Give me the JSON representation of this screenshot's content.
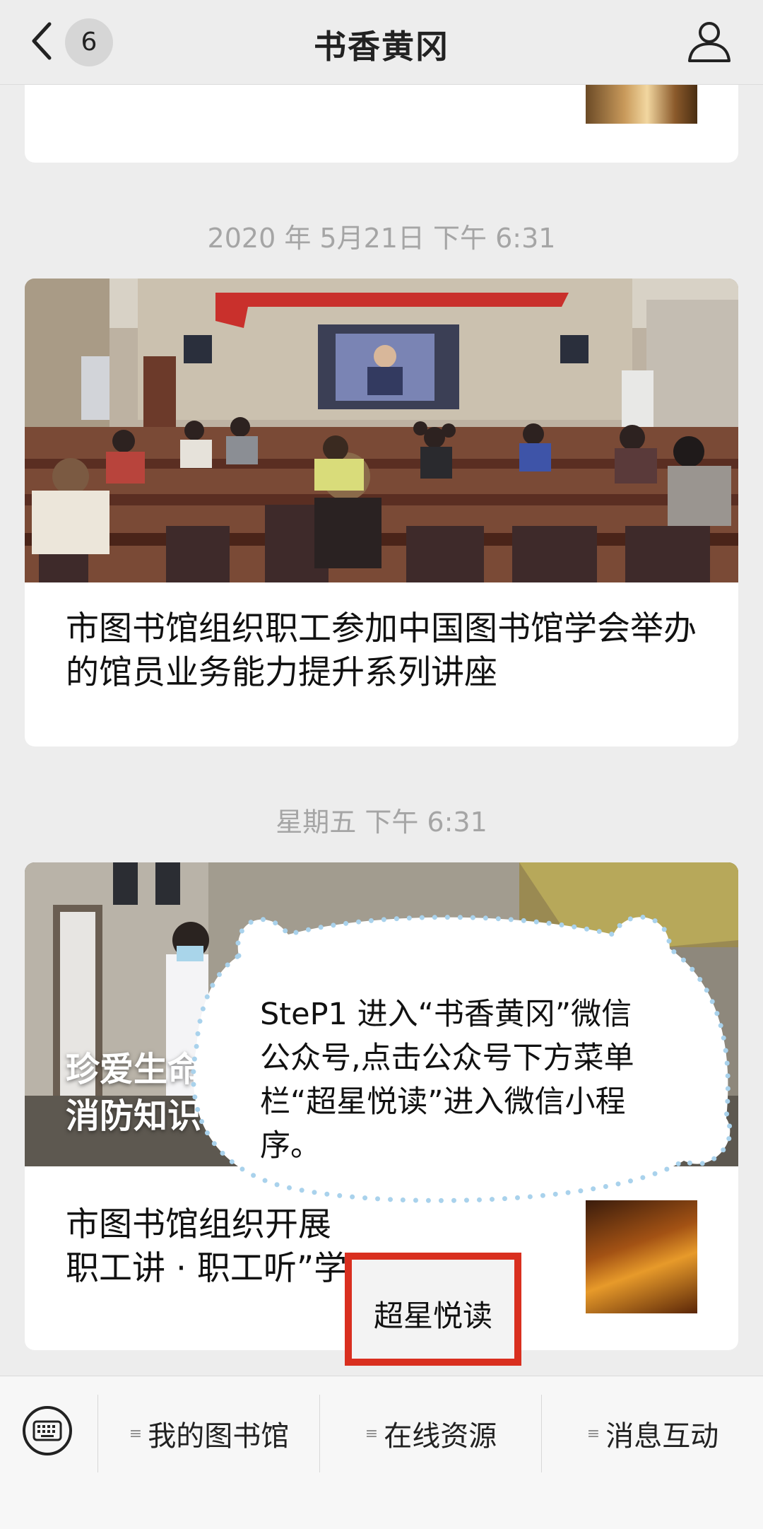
{
  "header": {
    "badge_count": "6",
    "title": "书香黄冈"
  },
  "feed": {
    "timestamp_1": "2020 年 5月21日 下午 6:31",
    "article_1_title": "市图书馆组织职工参加中国图书馆学会举办的馆员业务能力提升系列讲座",
    "timestamp_2": "星期五 下午 6:31",
    "article_2_overlay_title_line1": "珍爱生命",
    "article_2_overlay_title_line2": "消防知识",
    "article_2_subtitle_line1": "市图书馆组织开展",
    "article_2_subtitle_line2": "职工讲 · 职工听”学"
  },
  "callout": {
    "text": "SteP1 进入“书香黄冈”微信公众号,点击公众号下方菜单栏“超星悦读”进入微信小程序。",
    "highlight_label": "超星悦读",
    "highlight_color": "#d92f1f"
  },
  "menu": {
    "items": [
      {
        "label": "我的图书馆"
      },
      {
        "label": "在线资源"
      },
      {
        "label": "消息互动"
      }
    ]
  }
}
